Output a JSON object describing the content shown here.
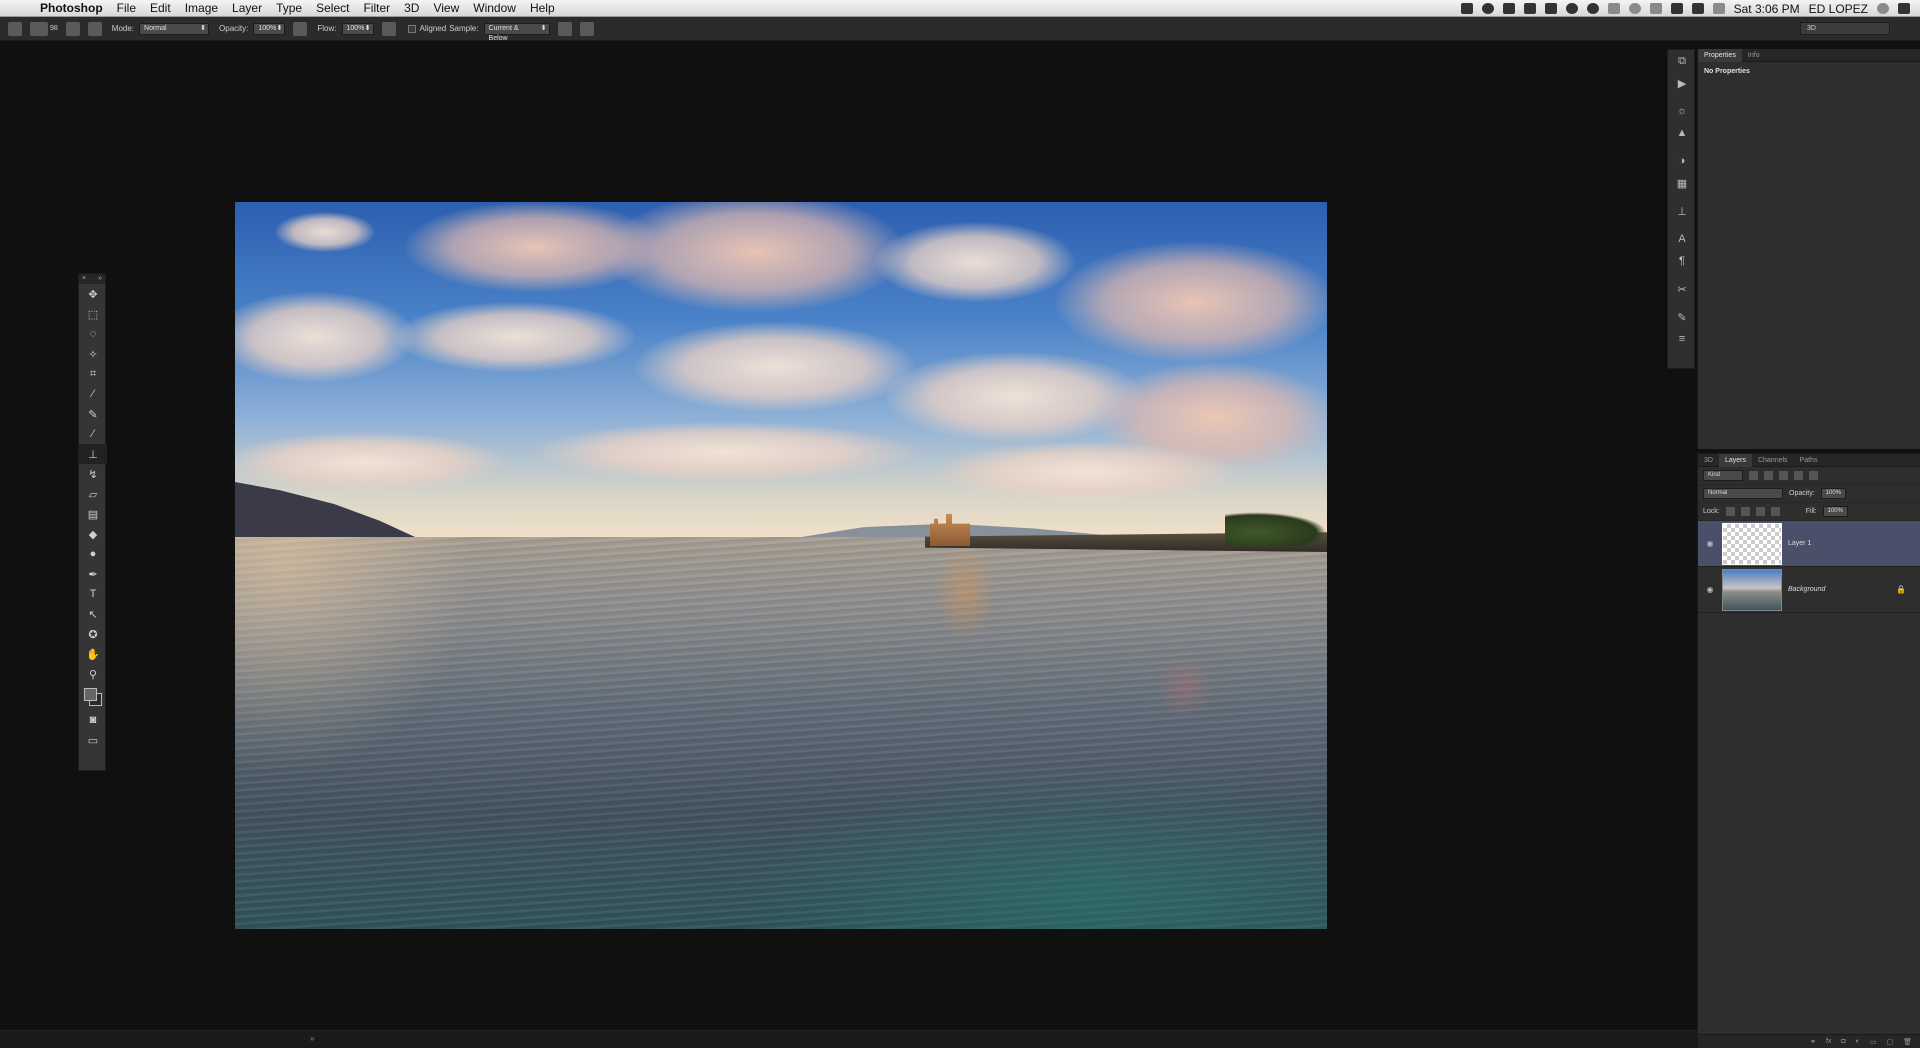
{
  "menubar": {
    "app_name": "Photoshop",
    "items": [
      "File",
      "Edit",
      "Image",
      "Layer",
      "Type",
      "Select",
      "Filter",
      "3D",
      "View",
      "Window",
      "Help"
    ],
    "clock": "Sat 3:06 PM",
    "user": "ED LOPEZ"
  },
  "options_bar": {
    "brush_size": "98",
    "mode_label": "Mode:",
    "mode_value": "Normal",
    "opacity_label": "Opacity:",
    "opacity_value": "100%",
    "flow_label": "Flow:",
    "flow_value": "100%",
    "aligned_label": "Aligned",
    "sample_label": "Sample:",
    "sample_value": "Current & Below",
    "workspace": "3D"
  },
  "properties_panel": {
    "tabs": [
      "Properties",
      "Info"
    ],
    "active_tab": "Properties",
    "message": "No Properties"
  },
  "layers_panel": {
    "tabs": [
      "3D",
      "Layers",
      "Channels",
      "Paths"
    ],
    "filter_label": "Kind",
    "blend_mode": "Normal",
    "opacity_label": "Opacity:",
    "opacity_value": "100%",
    "lock_label": "Lock:",
    "fill_label": "Fill:",
    "fill_value": "100%",
    "layers": [
      {
        "name": "Layer 1",
        "selected": true,
        "visible": true
      },
      {
        "name": "Background",
        "selected": false,
        "visible": true,
        "locked": true
      }
    ],
    "footer": [
      "link-icon",
      "fx",
      "mask-icon",
      "adjustment-icon",
      "folder-icon",
      "new-layer-icon",
      "trash-icon"
    ]
  },
  "colors": {
    "app_bg": "#101010",
    "panel_bg": "#2e2e2e",
    "selected_layer": "#4b506a"
  }
}
